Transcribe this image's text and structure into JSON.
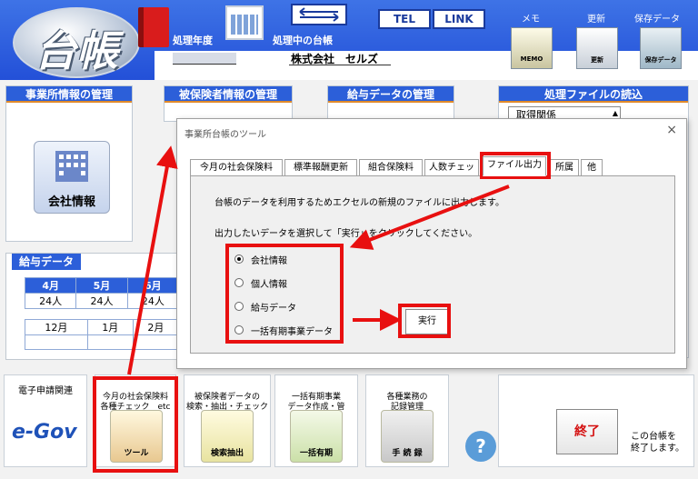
{
  "header": {
    "logo_text": "台帳",
    "fiscal_year_label": "処理年度",
    "current_ledger_label": "処理中の台帳",
    "company_name": "株式会社　セルズ",
    "tel_button": "TEL",
    "link_button": "LINK",
    "memo": {
      "label": "メモ",
      "icon_text": "MEMO"
    },
    "update": {
      "label": "更新",
      "icon_text": "更新"
    },
    "save": {
      "label": "保存データ",
      "icon_text": "保存データ"
    }
  },
  "panels": {
    "office": {
      "title": "事業所情報の管理",
      "button": "会社情報"
    },
    "insured": {
      "title": "被保険者情報の管理"
    },
    "salary": {
      "title": "給与データの管理"
    },
    "file_load": {
      "title": "処理ファイルの読込",
      "select_value": "取得関係"
    }
  },
  "salary_data": {
    "title": "給与データ",
    "row1": [
      {
        "month": "4月",
        "count": "24人"
      },
      {
        "month": "5月",
        "count": "24人"
      },
      {
        "month": "6月",
        "count": "24人"
      }
    ],
    "row2": [
      {
        "month": "12月"
      },
      {
        "month": "1月"
      },
      {
        "month": "2月"
      }
    ]
  },
  "bottom": {
    "e_app": {
      "label": "電子申請関連",
      "logo": "e-Gov"
    },
    "tools": {
      "label": "今月の社会保険料\n各種チェック　etc",
      "icon_text": "ツール"
    },
    "search": {
      "label": "被保険者データの\n検索・抽出・チェック",
      "icon_text": "検索抽出"
    },
    "bulk": {
      "label": "一括有期事業\nデータ作成・管",
      "icon_text": "一括有期"
    },
    "records": {
      "label": "各種業務の\n記録管理",
      "icon_text": "手 続 録"
    },
    "help": "?",
    "exit_button": "終了",
    "exit_text": "この台帳を\n終了します。"
  },
  "dialog": {
    "title": "事業所台帳のツール",
    "close": "×",
    "tabs": [
      "今月の社会保険料",
      "標準報酬更新",
      "組合保険料",
      "人数チェック",
      "ファイル出力",
      "所属",
      "他"
    ],
    "active_tab": "ファイル出力",
    "description": "台帳のデータを利用するためエクセルの新規のファイルに出力します。",
    "instruction": "出力したいデータを選択して「実行」をクリックしてください。",
    "options": [
      "会社情報",
      "個人情報",
      "給与データ",
      "一括有期事業データ"
    ],
    "selected_option": "会社情報",
    "execute_button": "実行"
  },
  "colors": {
    "header_blue": "#2c5fd9",
    "highlight_red": "#e81010"
  }
}
